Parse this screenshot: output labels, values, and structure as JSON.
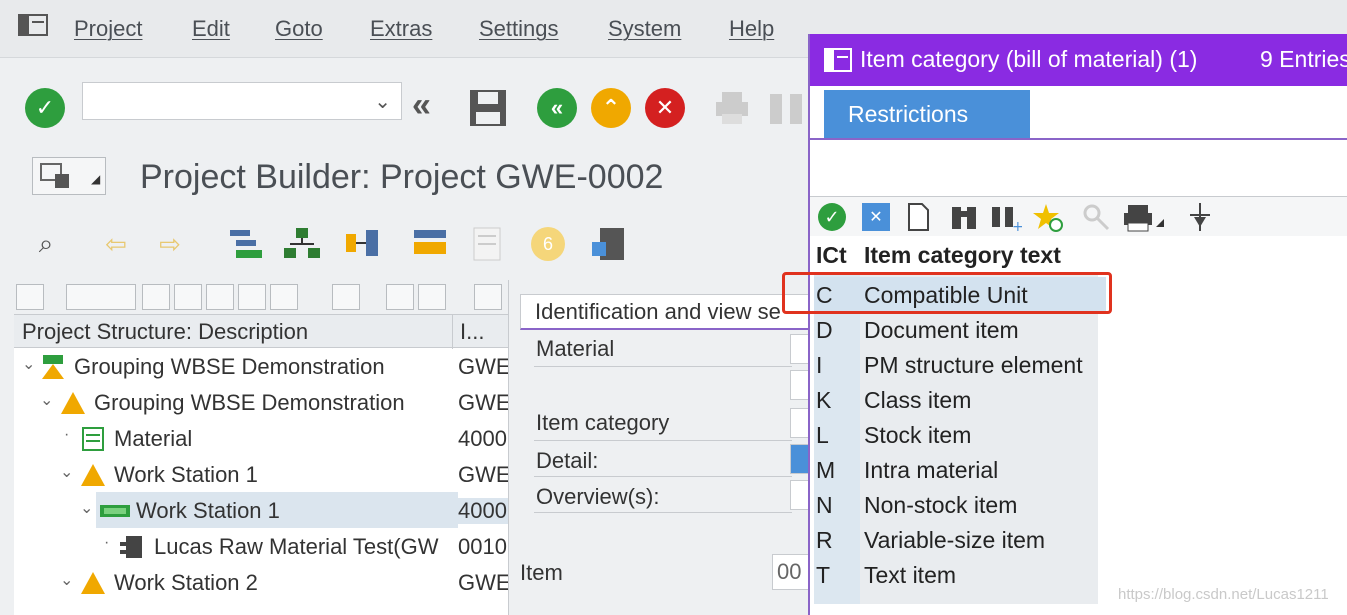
{
  "menu": {
    "items": [
      "Project",
      "Edit",
      "Goto",
      "Extras",
      "Settings",
      "System",
      "Help"
    ]
  },
  "toolbar": {
    "command_value": "",
    "icons": [
      "check-icon",
      "back-double-icon",
      "save-icon",
      "back-icon",
      "exit-icon",
      "cancel-icon",
      "print-icon",
      "find-icon"
    ]
  },
  "title": {
    "text": "Project Builder: Project GWE-0002"
  },
  "tree": {
    "header_desc": "Project Structure: Description",
    "header_id": "I...",
    "rows": [
      {
        "label": "Grouping WBSE Demonstration",
        "id": "GWE",
        "icon": "milestone-icon",
        "level": 0
      },
      {
        "label": "Grouping WBSE Demonstration",
        "id": "GWE",
        "icon": "wbs-element-icon",
        "level": 1
      },
      {
        "label": "Material",
        "id": "4000",
        "icon": "material-icon",
        "level": 2
      },
      {
        "label": "Work Station 1",
        "id": "GWE",
        "icon": "wbs-element-icon",
        "level": 2
      },
      {
        "label": "Work Station 1",
        "id": "4000",
        "icon": "network-icon",
        "level": 3
      },
      {
        "label": "Lucas Raw Material Test(GW",
        "id": "0010",
        "icon": "component-icon",
        "level": 4
      },
      {
        "label": "Work Station 2",
        "id": "GWE",
        "icon": "wbs-element-icon",
        "level": 2
      }
    ]
  },
  "detail": {
    "tab_label": "Identification and view se",
    "material_label": "Material",
    "item_category_label": "Item category",
    "detail_label": "Detail:",
    "overview_label": "Overview(s):",
    "item_label": "Item",
    "item_value": "00"
  },
  "popup": {
    "title": "Item category (bill of material) (1)",
    "count": "9 Entries",
    "restrictions_tab": "Restrictions",
    "col_code": "ICt",
    "col_text": "Item category text",
    "rows": [
      {
        "code": "C",
        "text": "Compatible Unit"
      },
      {
        "code": "D",
        "text": "Document item"
      },
      {
        "code": "I",
        "text": "PM structure element"
      },
      {
        "code": "K",
        "text": "Class item"
      },
      {
        "code": "L",
        "text": "Stock item"
      },
      {
        "code": "M",
        "text": "Intra material"
      },
      {
        "code": "N",
        "text": "Non-stock item"
      },
      {
        "code": "R",
        "text": "Variable-size item"
      },
      {
        "code": "T",
        "text": "Text item"
      }
    ]
  },
  "watermark": "https://blog.csdn.net/Lucas1211",
  "colors": {
    "popup_title_bg": "#8a2be2",
    "restrictions_tab_bg": "#4a90d9",
    "highlight": "#e0321e",
    "check_green": "#2e9e3e",
    "cancel_red": "#d42020",
    "exit_orange": "#f0a800"
  }
}
